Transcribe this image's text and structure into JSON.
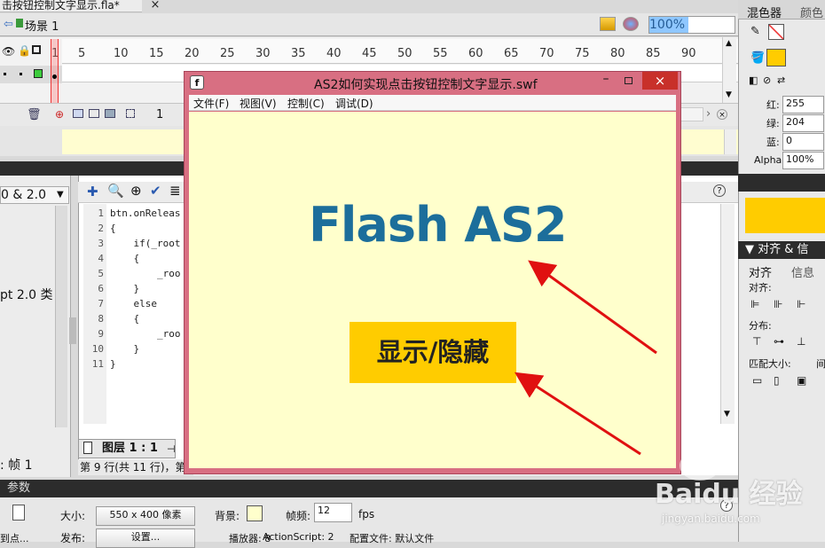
{
  "document": {
    "tab_title": "击按钮控制文字显示.fla*",
    "scene_label": "场景 1",
    "zoom": "100%"
  },
  "timeline": {
    "ruler_ticks": [
      "1",
      "5",
      "10",
      "15",
      "20",
      "25",
      "30",
      "35",
      "40",
      "45",
      "50",
      "55",
      "60",
      "65",
      "70",
      "75",
      "80",
      "85",
      "90"
    ],
    "current_frame": "1"
  },
  "left_panel": {
    "dropdown": "0 & 2.0",
    "class_text": "pt 2.0 类",
    "frame_label": ": 帧 1"
  },
  "editor": {
    "line_numbers": [
      "1",
      "2",
      "3",
      "4",
      "5",
      "6",
      "7",
      "8",
      "9",
      "10",
      "11"
    ],
    "lines": [
      "btn.onReleas",
      "{",
      "    if(_root",
      "    {",
      "        _roo",
      "    }",
      "    else",
      "    {",
      "        _roo",
      "    }",
      "}"
    ],
    "layer_tab": "图层 1 : 1",
    "status": "第 9 行(共 11 行)，第"
  },
  "properties": {
    "title": "参数",
    "size_label": "大小:",
    "size_value": "550 x 400 像素",
    "bg_label": "背景:",
    "fps_label": "帧频:",
    "fps_value": "12",
    "fps_unit": "fps",
    "publish_label": "发布:",
    "settings_button": "设置...",
    "player_label": "播放器: 8",
    "as_label": "ActionScript: 2",
    "profile_label": "配置文件: 默认文件",
    "left_cut": "到点...",
    "help_icon": "help-icon"
  },
  "right_panel": {
    "tab_mixer": "混色器",
    "tab_color": "颜色",
    "red_label": "红:",
    "red_value": "255",
    "green_label": "绿:",
    "green_value": "204",
    "blue_label": "蓝:",
    "blue_value": "0",
    "alpha_label": "Alpha:",
    "alpha_value": "100%",
    "fill_color": "#ffcc00",
    "align_header": "▼ 对齐 & 信",
    "tab_align": "对齐",
    "tab_info": "信息",
    "align_label": "对齐:",
    "distribute_label": "分布:",
    "match_size_label": "匹配大小:",
    "spacing_label": "间"
  },
  "swf_window": {
    "title": "AS2如何实现点击按钮控制文字显示.swf",
    "menu": [
      "文件(F)",
      "视图(V)",
      "控制(C)",
      "调试(D)"
    ],
    "flash_text": "Flash AS2",
    "toggle_button": "显示/隐藏",
    "stage_color": "#ffffcc",
    "text_color": "#1c6e9b",
    "arrow_color": "#e01010"
  },
  "watermark": {
    "brand": "Baidu 经验",
    "url": "jingyan.baidu.com"
  }
}
